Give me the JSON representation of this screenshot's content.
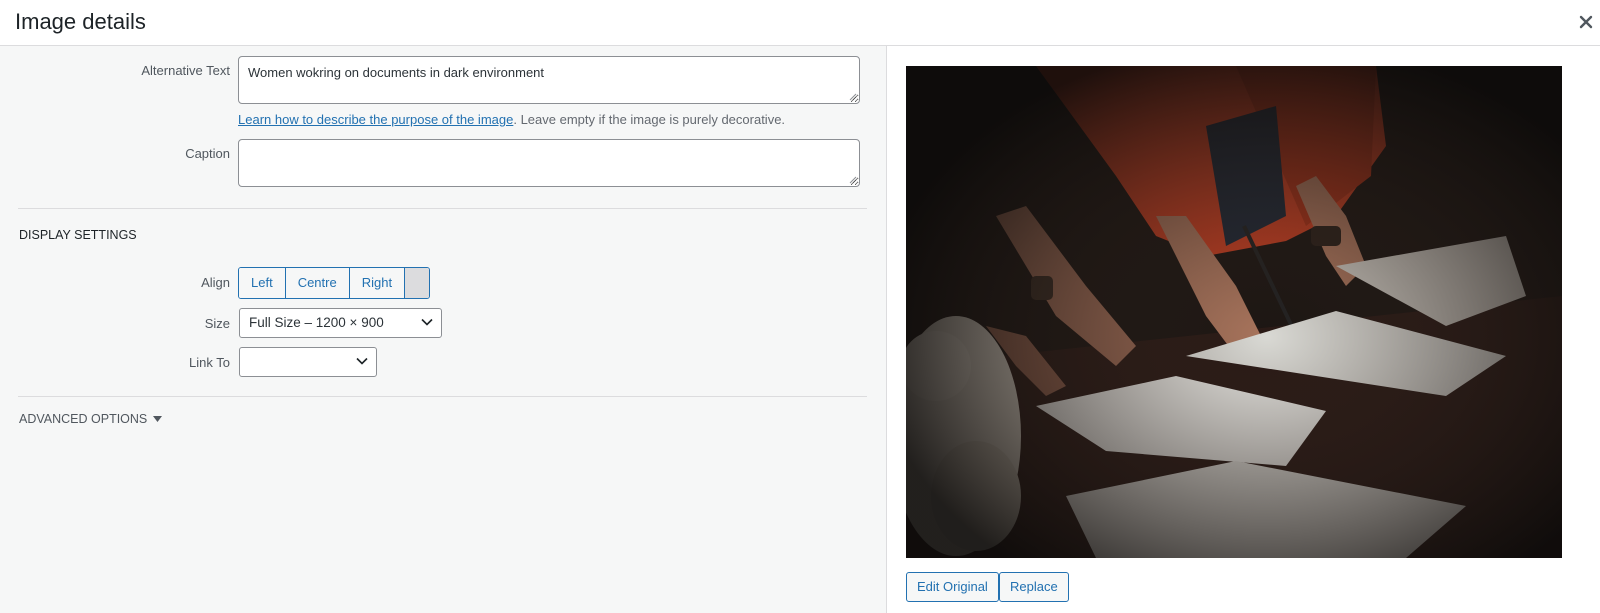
{
  "header": {
    "title": "Image details"
  },
  "fields": {
    "alt_label": "Alternative Text",
    "alt_value": "Women wokring on documents in dark environment",
    "help_link": "Learn how to describe the purpose of the image",
    "help_rest": ". Leave empty if the image is purely decorative.",
    "caption_label": "Caption",
    "caption_value": ""
  },
  "display": {
    "section_title": "DISPLAY SETTINGS",
    "align_label": "Align",
    "align_options": [
      "Left",
      "Centre",
      "Right"
    ],
    "size_label": "Size",
    "size_value": "Full Size – 1200 × 900",
    "link_label": "Link To",
    "link_value": ""
  },
  "advanced": {
    "label": "ADVANCED OPTIONS"
  },
  "preview": {
    "edit_label": "Edit Original",
    "replace_label": "Replace"
  },
  "colors": {
    "accent": "#2271b1",
    "pane": "#f6f7f7",
    "border": "#8c8f94"
  }
}
